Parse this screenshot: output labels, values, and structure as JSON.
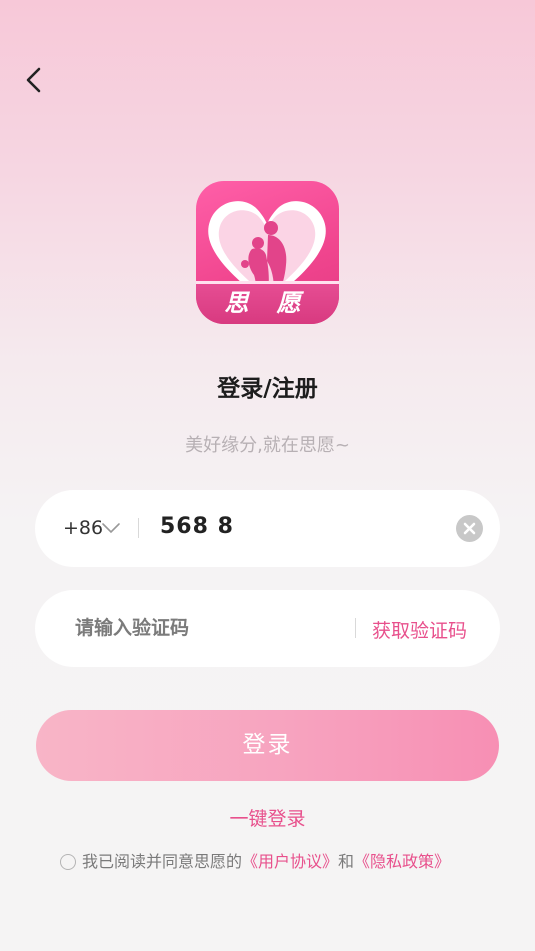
{
  "header": {
    "back_icon": "chevron-left-icon"
  },
  "logo": {
    "word": "思 愿",
    "icon": "heart-couple-icon"
  },
  "title": "登录/注册",
  "subtitle": "美好缘分,就在思愿~",
  "phone": {
    "country_code": "+86",
    "value": "568 8",
    "clear_icon": "clear-circle-icon",
    "chevron_icon": "chevron-down-icon"
  },
  "code": {
    "placeholder": "请输入验证码",
    "get_code_label": "获取验证码"
  },
  "login_label": "登录",
  "one_key_login": "一键登录",
  "agreement": {
    "prefix": "我已阅读并同意思愿的",
    "user_agreement": "《用户协议》",
    "and": "和",
    "privacy_policy": "《隐私政策》"
  },
  "colors": {
    "accent": "#e8508c",
    "button_start": "#f8b5c7",
    "button_end": "#f78fb4",
    "logo": "#f0458e"
  }
}
